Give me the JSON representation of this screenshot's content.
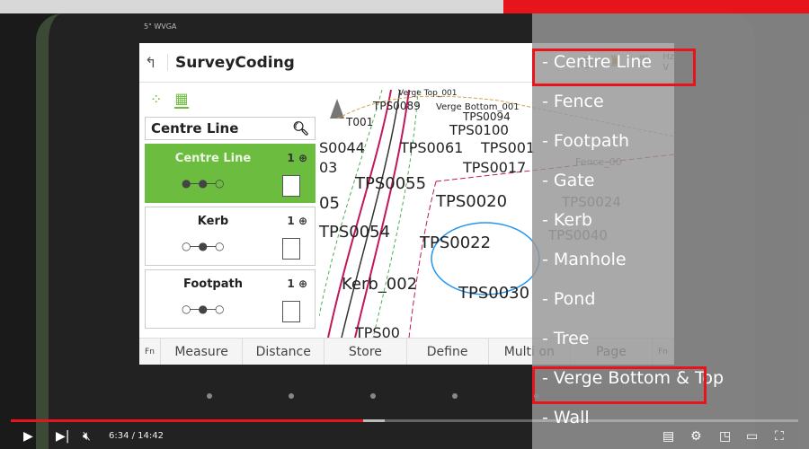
{
  "device": {
    "label": "5\" WVGA"
  },
  "app": {
    "title": "SurveyCoding",
    "hz_label": "Hz",
    "v_label": "V",
    "search_value": "Centre Line",
    "codes": [
      {
        "name": "Centre Line",
        "count": "1",
        "active": true
      },
      {
        "name": "Kerb",
        "count": "1",
        "active": false
      },
      {
        "name": "Footpath",
        "count": "1",
        "active": false
      }
    ],
    "softkeys": [
      "Fn",
      "Measure",
      "Distance",
      "Store",
      "Define",
      "Multi on",
      "Page",
      "Fn"
    ]
  },
  "map": {
    "labels": [
      "Verge Top_001",
      "TPS0089",
      "Verge Bottom_001",
      "T001",
      "TPS0094",
      "TPS0100",
      "S0044",
      "TPS0061",
      "TPS001",
      "03",
      "TPS0017",
      "TPS0055",
      "TPS0020",
      "05",
      "TPS0054",
      "TPS0022",
      "Kerb_002",
      "TPS0030",
      "TPS00"
    ]
  },
  "captions": {
    "items": [
      "- Centre Line",
      "- Fence",
      "- Footpath",
      "- Gate",
      "- Kerb",
      "- Manhole",
      "- Pond",
      "- Tree",
      "- Verge Bottom & Top",
      "- Wall"
    ],
    "highlighted": [
      "- Centre Line",
      "- Verge Bottom & Top"
    ]
  },
  "player": {
    "current_time": "6:34",
    "duration": "14:42",
    "time_display": "6:34 / 14:42",
    "progress_percent": 44.7,
    "buffered_percent": 47.5,
    "muted": true,
    "accent": "#e8141b"
  }
}
